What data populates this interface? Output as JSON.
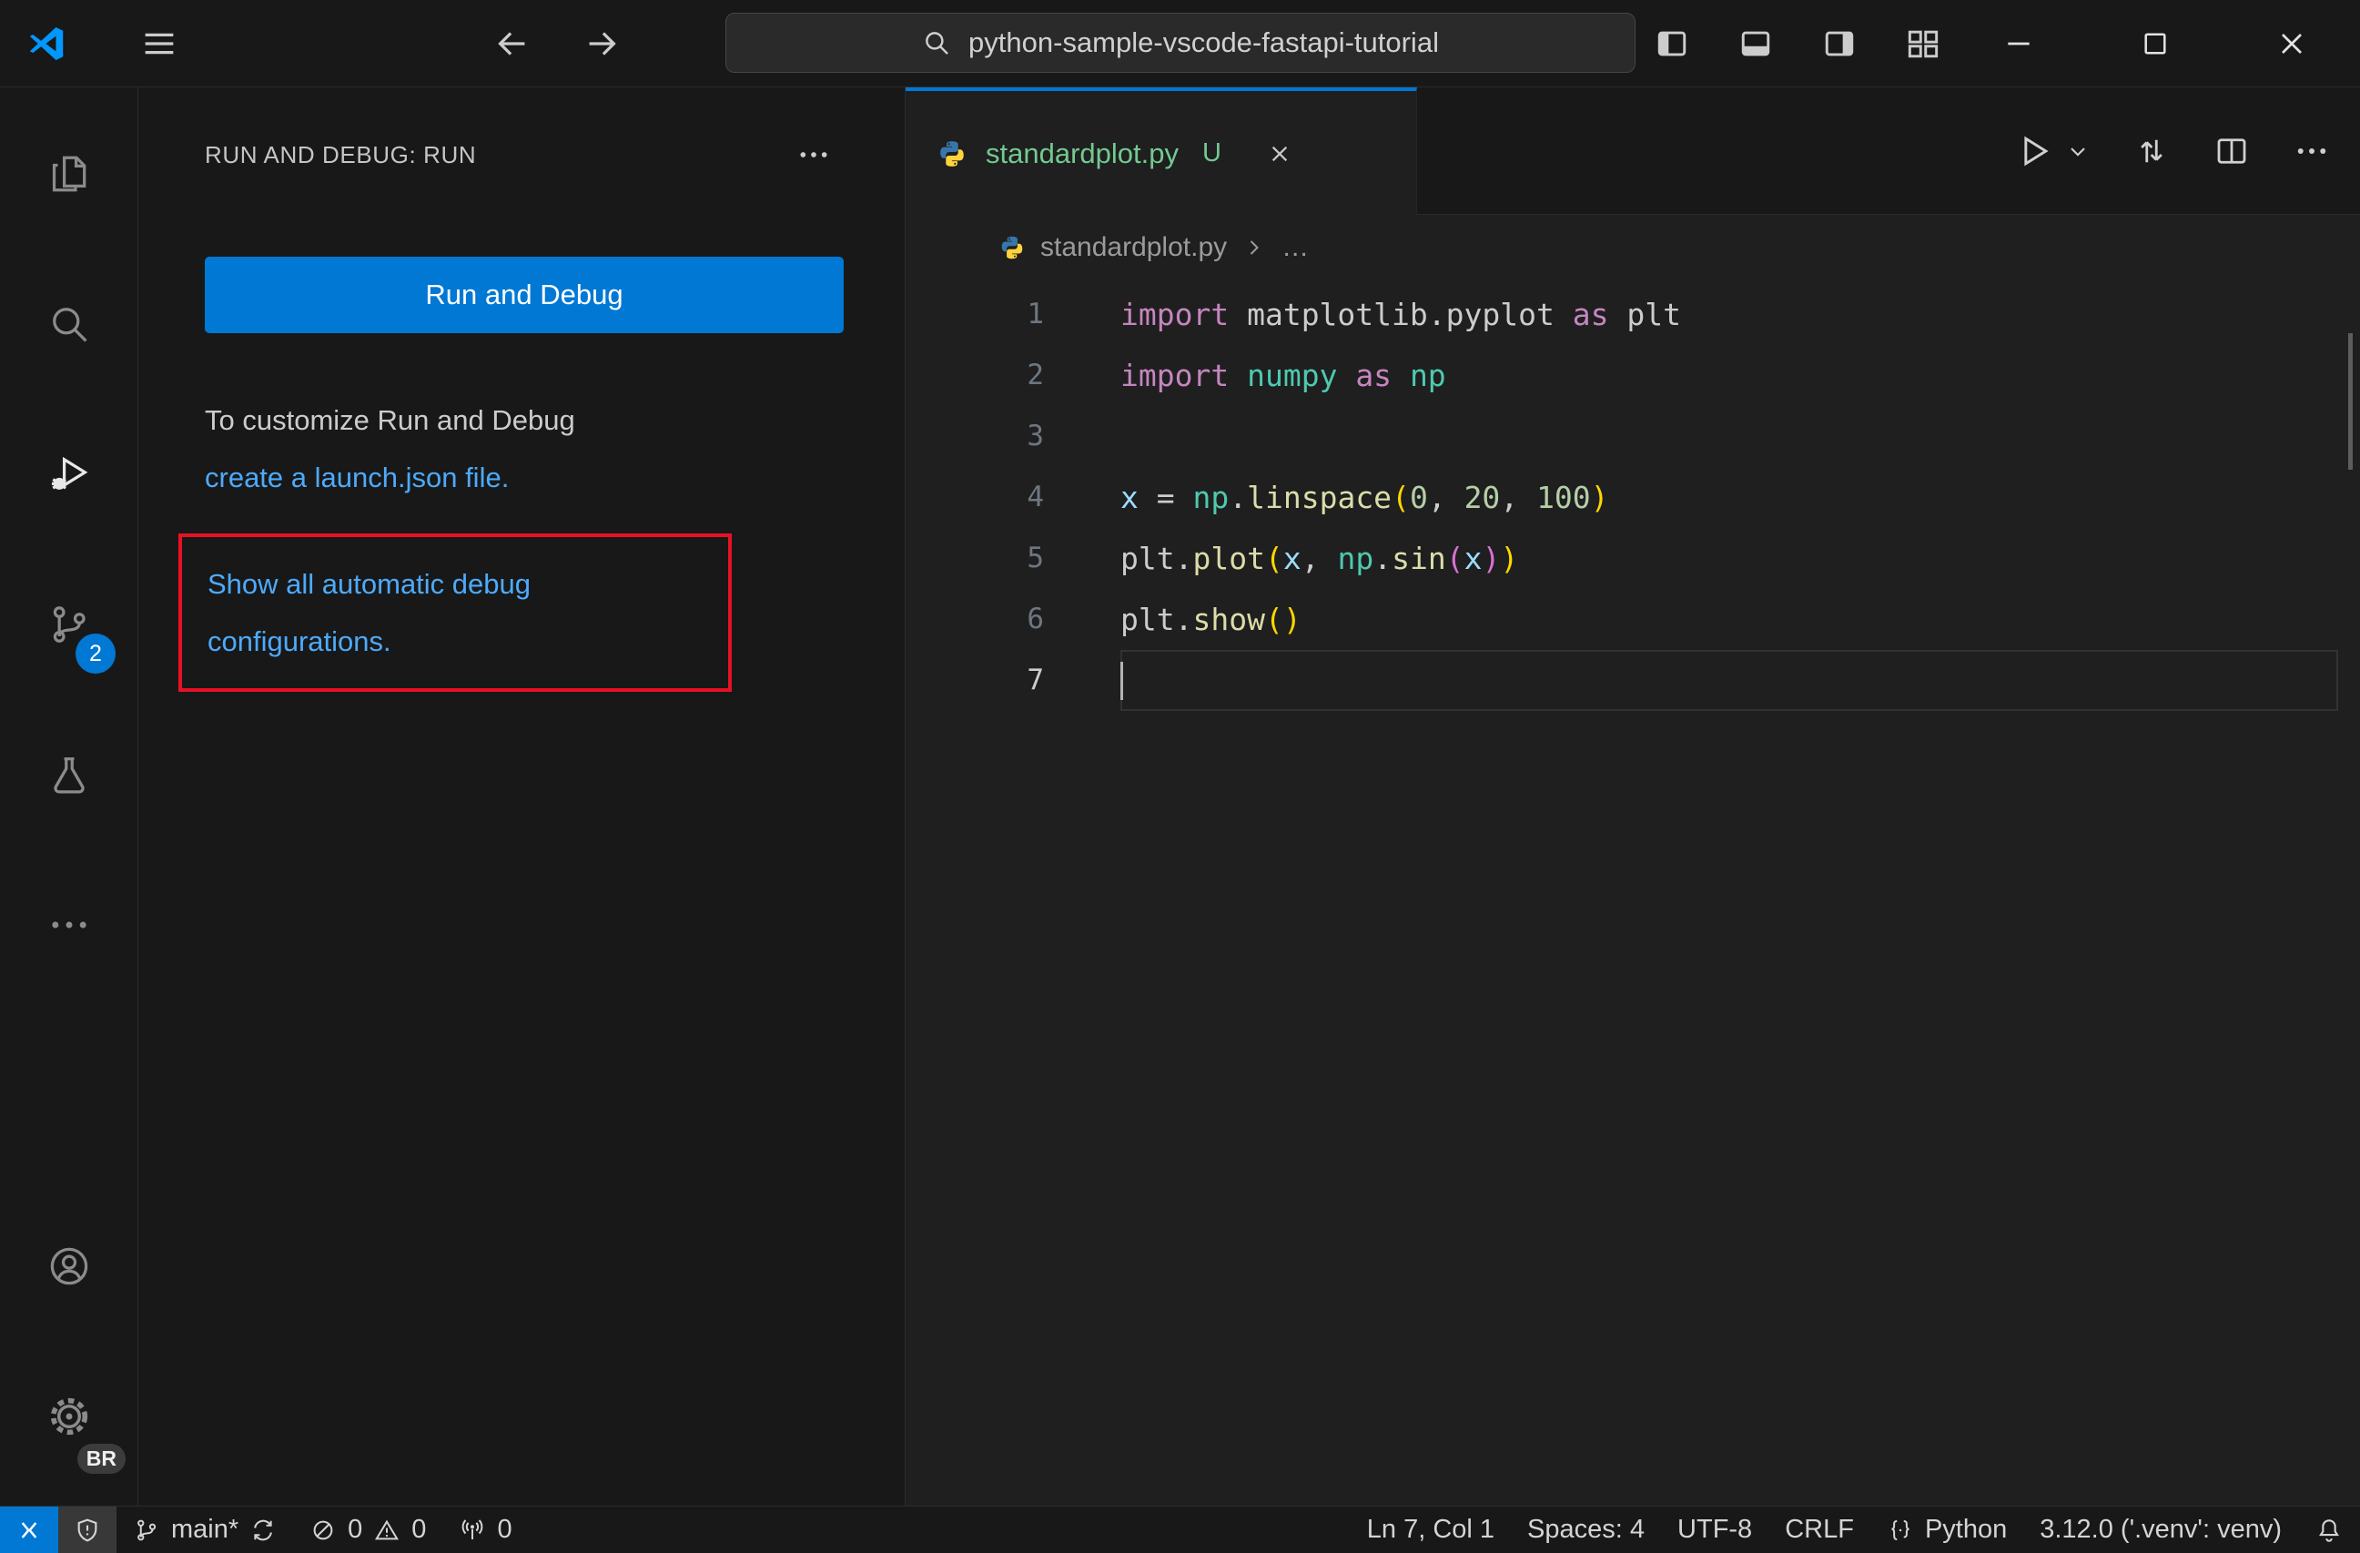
{
  "window": {
    "command_center_query": "python-sample-vscode-fastapi-tutorial"
  },
  "activity_bar": {
    "scm_badge": "2",
    "profile_initials": "BR"
  },
  "sidebar": {
    "title": "RUN AND DEBUG: RUN",
    "run_and_debug_button": "Run and Debug",
    "customize_line1": "To customize Run and Debug",
    "customize_link": "create a launch.json file.",
    "auto_configs_link": "Show all automatic debug configurations."
  },
  "editor": {
    "tab_label": "standardplot.py",
    "tab_modified_badge": "U",
    "breadcrumb_file": "standardplot.py",
    "breadcrumb_more": "…",
    "code_lines": [
      {
        "num": 1,
        "tokens": [
          [
            "kw",
            "import"
          ],
          [
            "tx",
            " matplotlib.pyplot "
          ],
          [
            "kw",
            "as"
          ],
          [
            "tx",
            " plt"
          ]
        ]
      },
      {
        "num": 2,
        "tokens": [
          [
            "kw",
            "import"
          ],
          [
            "tx",
            " "
          ],
          [
            "mod",
            "numpy"
          ],
          [
            "tx",
            " "
          ],
          [
            "kw",
            "as"
          ],
          [
            "tx",
            " "
          ],
          [
            "mod",
            "np"
          ]
        ]
      },
      {
        "num": 3,
        "tokens": []
      },
      {
        "num": 4,
        "tokens": [
          [
            "var",
            "x"
          ],
          [
            "tx",
            " = "
          ],
          [
            "mod",
            "np"
          ],
          [
            "tx",
            "."
          ],
          [
            "fn",
            "linspace"
          ],
          [
            "b1",
            "("
          ],
          [
            "num",
            "0"
          ],
          [
            "tx",
            ", "
          ],
          [
            "num",
            "20"
          ],
          [
            "tx",
            ", "
          ],
          [
            "num",
            "100"
          ],
          [
            "b1",
            ")"
          ]
        ]
      },
      {
        "num": 5,
        "tokens": [
          [
            "tx",
            "plt"
          ],
          [
            "tx",
            "."
          ],
          [
            "fn",
            "plot"
          ],
          [
            "b1",
            "("
          ],
          [
            "var",
            "x"
          ],
          [
            "tx",
            ", "
          ],
          [
            "mod",
            "np"
          ],
          [
            "tx",
            "."
          ],
          [
            "fn",
            "sin"
          ],
          [
            "b2",
            "("
          ],
          [
            "var",
            "x"
          ],
          [
            "b2",
            ")"
          ],
          [
            "b1",
            ")"
          ]
        ]
      },
      {
        "num": 6,
        "tokens": [
          [
            "tx",
            "plt"
          ],
          [
            "tx",
            "."
          ],
          [
            "fn",
            "show"
          ],
          [
            "b1",
            "("
          ],
          [
            "b1",
            ")"
          ]
        ]
      },
      {
        "num": 7,
        "tokens": [],
        "current": true
      }
    ]
  },
  "status_bar": {
    "branch": "main*",
    "errors": "0",
    "warnings": "0",
    "ports": "0",
    "line_col": "Ln 7, Col 1",
    "indentation": "Spaces: 4",
    "encoding": "UTF-8",
    "eol": "CRLF",
    "language": "Python",
    "interpreter": "3.12.0 ('.venv': venv)"
  }
}
